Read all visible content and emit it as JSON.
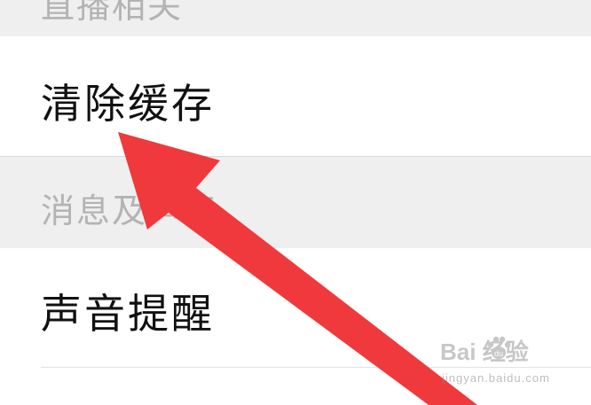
{
  "sections": {
    "live_header": "直播相关",
    "clear_cache": "清除缓存",
    "message_header": "消息及声音",
    "sound_reminder": "声音提醒"
  },
  "watermark": {
    "brand": "Bai  经验",
    "url": "jingyan.baidu.com"
  },
  "annotation": {
    "arrow_color": "#f0393c"
  }
}
